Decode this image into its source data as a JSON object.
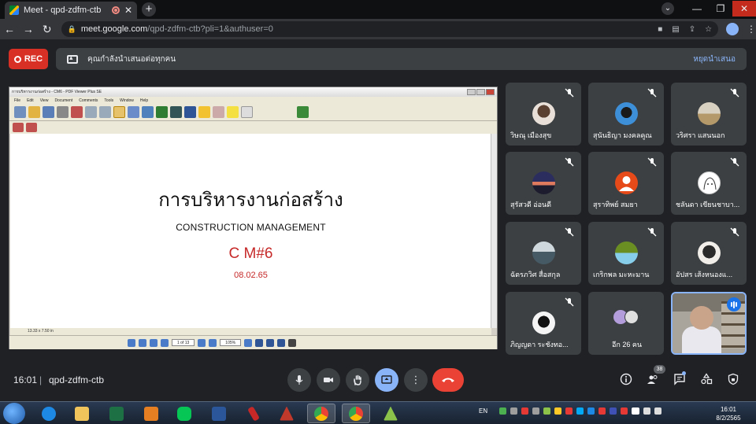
{
  "browser": {
    "tab_title": "Meet - qpd-zdfm-ctb",
    "tab_close": "✕",
    "new_tab": "+",
    "url_host": "meet.google.com",
    "url_path": "/qpd-zdfm-ctb?pli=1&authuser=0"
  },
  "meet": {
    "rec_label": "REC",
    "banner_text": "คุณกำลังนำเสนอต่อทุกคน",
    "stop_presenting": "หยุดนำเสนอ",
    "time": "16:01",
    "separator": "|",
    "meeting_code": "qpd-zdfm-ctb",
    "people_count": "38"
  },
  "pdf": {
    "window_title": "การบริหารงานก่อสร้าง - CM6 - PDF Viewer Plus SE",
    "menu": [
      "File",
      "Edit",
      "View",
      "Document",
      "Comments",
      "Tools",
      "Window",
      "Help"
    ],
    "page_size": "13.33 x 7.50 in",
    "page_indicator": "1 of 13",
    "zoom": "105%"
  },
  "slide": {
    "title": "การบริหารงานก่อสร้าง",
    "subtitle": "CONSTRUCTION MANAGEMENT",
    "code": "C M#6",
    "date": "08.02.65"
  },
  "participants": [
    {
      "name": "วิษณุ เมืองสุข"
    },
    {
      "name": "สุนันธิญา มงคลคูณ"
    },
    {
      "name": "วริศรา แสนนอก"
    },
    {
      "name": "สุรัสวดี อ่อนดี"
    },
    {
      "name": "สุราทิพย์ สมยา"
    },
    {
      "name": "ชลันดา เขียนชาบา..."
    },
    {
      "name": "ฉัตรภวิศ สื่อสกุล"
    },
    {
      "name": "เกริกพล มะหะมาน"
    },
    {
      "name": "อัปสร เส้งหนองแ..."
    },
    {
      "name": "ภิญญดา ระชังทอ..."
    },
    {
      "name": "อีก 26 คน"
    }
  ],
  "taskbar": {
    "lang": "EN",
    "clock_time": "16:01",
    "clock_date": "8/2/2565"
  },
  "colors": {
    "rec_red": "#d93025",
    "meet_blue": "#8ab4f8",
    "hangup_red": "#ea4335",
    "slide_red": "#c62828"
  }
}
